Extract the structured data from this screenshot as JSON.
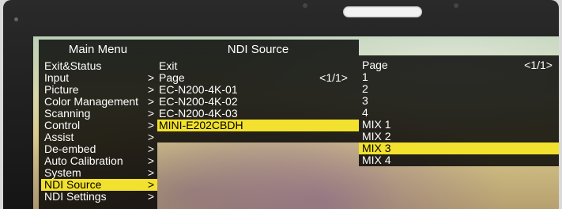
{
  "main_menu": {
    "title": "Main Menu",
    "items": [
      {
        "label": "Exit&Status",
        "arrow": ""
      },
      {
        "label": "Input",
        "arrow": ">"
      },
      {
        "label": "Picture",
        "arrow": ">"
      },
      {
        "label": "Color Management",
        "arrow": ">"
      },
      {
        "label": "Scanning",
        "arrow": ">"
      },
      {
        "label": "Control",
        "arrow": ">"
      },
      {
        "label": "Assist",
        "arrow": ">"
      },
      {
        "label": "De-embed",
        "arrow": ">"
      },
      {
        "label": "Auto Calibration",
        "arrow": ">"
      },
      {
        "label": "System",
        "arrow": ">"
      },
      {
        "label": "NDI Source",
        "arrow": ">"
      },
      {
        "label": "NDI Settings",
        "arrow": ">"
      }
    ]
  },
  "ndi_source": {
    "title": "NDI Source",
    "items": [
      {
        "label": "Exit",
        "arrow": ""
      },
      {
        "label": "Page",
        "arrow": "<1/1>"
      },
      {
        "label": "EC-N200-4K-01",
        "arrow": ""
      },
      {
        "label": "EC-N200-4K-02",
        "arrow": ""
      },
      {
        "label": "EC-N200-4K-03",
        "arrow": ""
      },
      {
        "label": "MINI-E202CBDH",
        "arrow": ""
      }
    ]
  },
  "sub_menu": {
    "items": [
      {
        "label": "Page",
        "arrow": "<1/1>"
      },
      {
        "label": "1",
        "arrow": ""
      },
      {
        "label": "2",
        "arrow": ""
      },
      {
        "label": "3",
        "arrow": ""
      },
      {
        "label": "4",
        "arrow": ""
      },
      {
        "label": "MIX 1",
        "arrow": ""
      },
      {
        "label": "MIX 2",
        "arrow": ""
      },
      {
        "label": "MIX 3",
        "arrow": ""
      },
      {
        "label": "MIX 4",
        "arrow": ""
      }
    ]
  },
  "colors": {
    "highlight": "#f2e12e",
    "panel": "#000000",
    "text": "#ffffff"
  }
}
